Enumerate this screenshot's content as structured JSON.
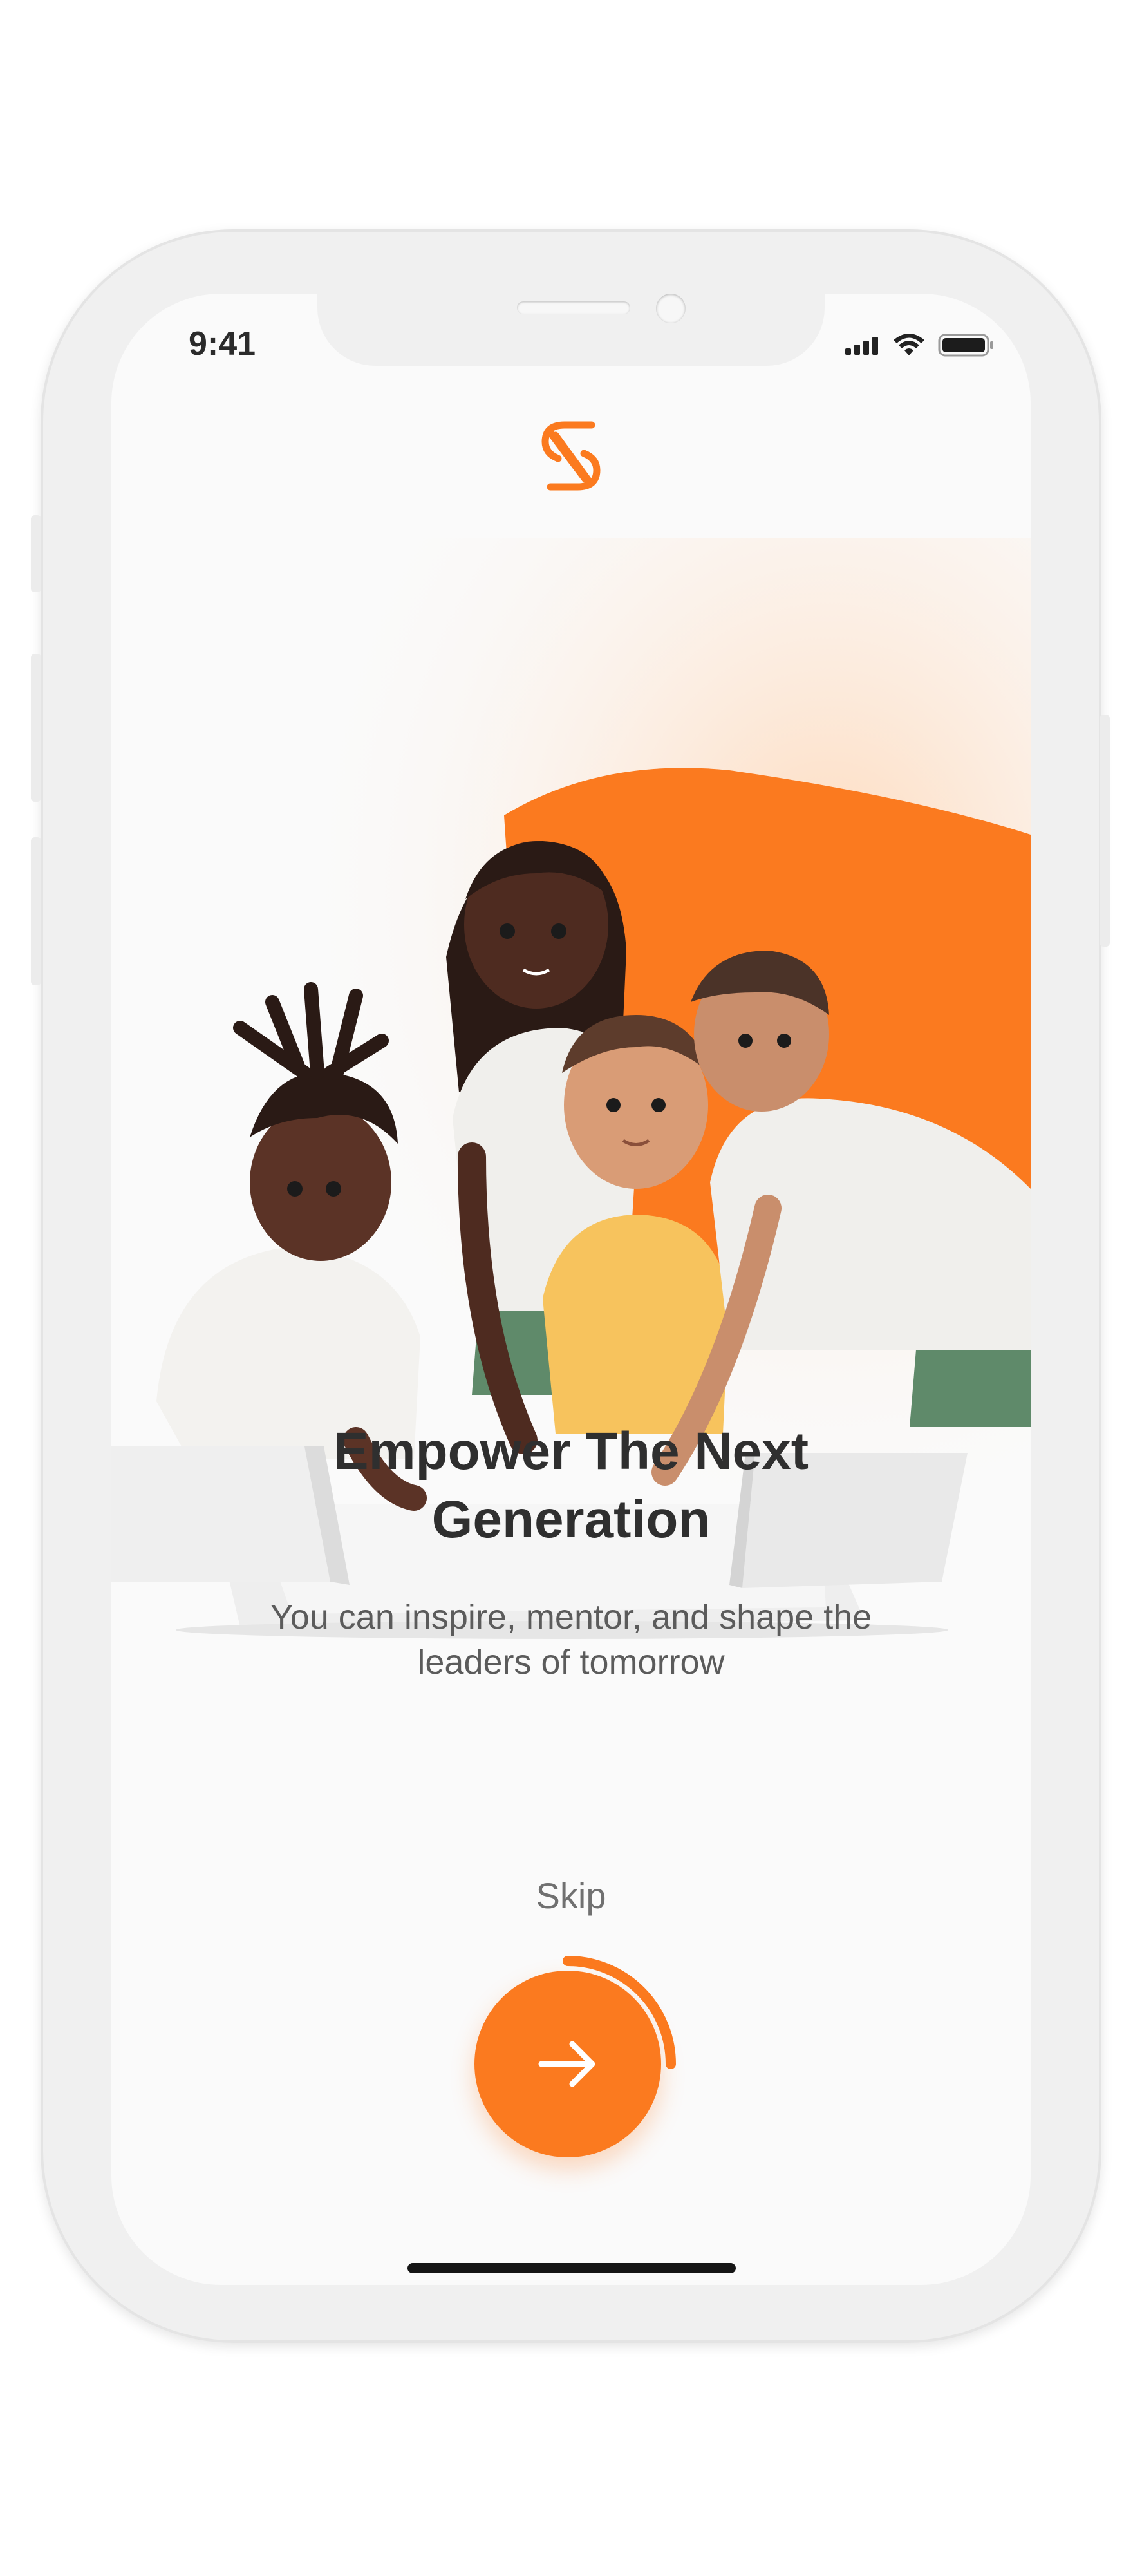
{
  "status_bar": {
    "time": "9:41"
  },
  "onboarding": {
    "title_line1": "Empower The Next",
    "title_line2": "Generation",
    "subtitle_line1": "You can inspire, mentor, and shape the",
    "subtitle_line2": "leaders of tomorrow",
    "skip_label": "Skip",
    "progress": 0.25
  },
  "icons": {
    "logo": "brand-s-logo-icon",
    "next": "arrow-right-icon",
    "signal": "cellular-signal-icon",
    "wifi": "wifi-icon",
    "battery": "battery-icon"
  },
  "colors": {
    "accent": "#fb7a1f",
    "background": "#fafafa",
    "title": "#2f2f2f",
    "subtitle": "#5b5b5b"
  }
}
